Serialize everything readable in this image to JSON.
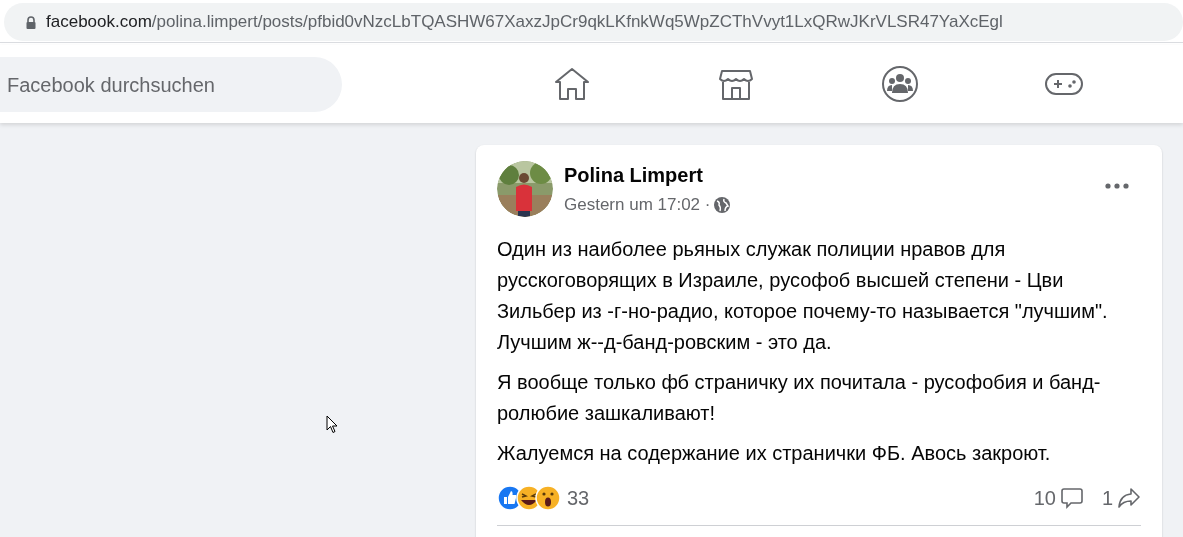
{
  "address_bar": {
    "domain": "facebook.com",
    "path": "/polina.limpert/posts/pfbid0vNzcLbTQASHW67XaxzJpCr9qkLKfnkWq5WpZCThVvyt1LxQRwJKrVLSR47YaXcEgl"
  },
  "search": {
    "placeholder": "Facebook durchsuchen"
  },
  "nav": [
    {
      "kind": "home"
    },
    {
      "kind": "store"
    },
    {
      "kind": "groups"
    },
    {
      "kind": "gaming"
    }
  ],
  "post": {
    "author": "Polina Limpert",
    "time": "Gestern um 17:02 ·",
    "paragraphs": [
      "Один из наиболее рьяных служак полиции нравов для русскоговорящих в Израиле, русофоб высшей степени - Цви Зильбер из -г-но-радио, которое почему-то называется \"лучшим\". Лучшим ж--д-банд-ровским - это да.",
      "Я вообще только фб страничку их почитала - русофобия и банд-ролюбие зашкаливают!",
      "Жалуемся на содержание их странички ФБ. Авось закроют."
    ],
    "reactions_count": "33",
    "comments_count": "10",
    "shares_count": "1"
  }
}
